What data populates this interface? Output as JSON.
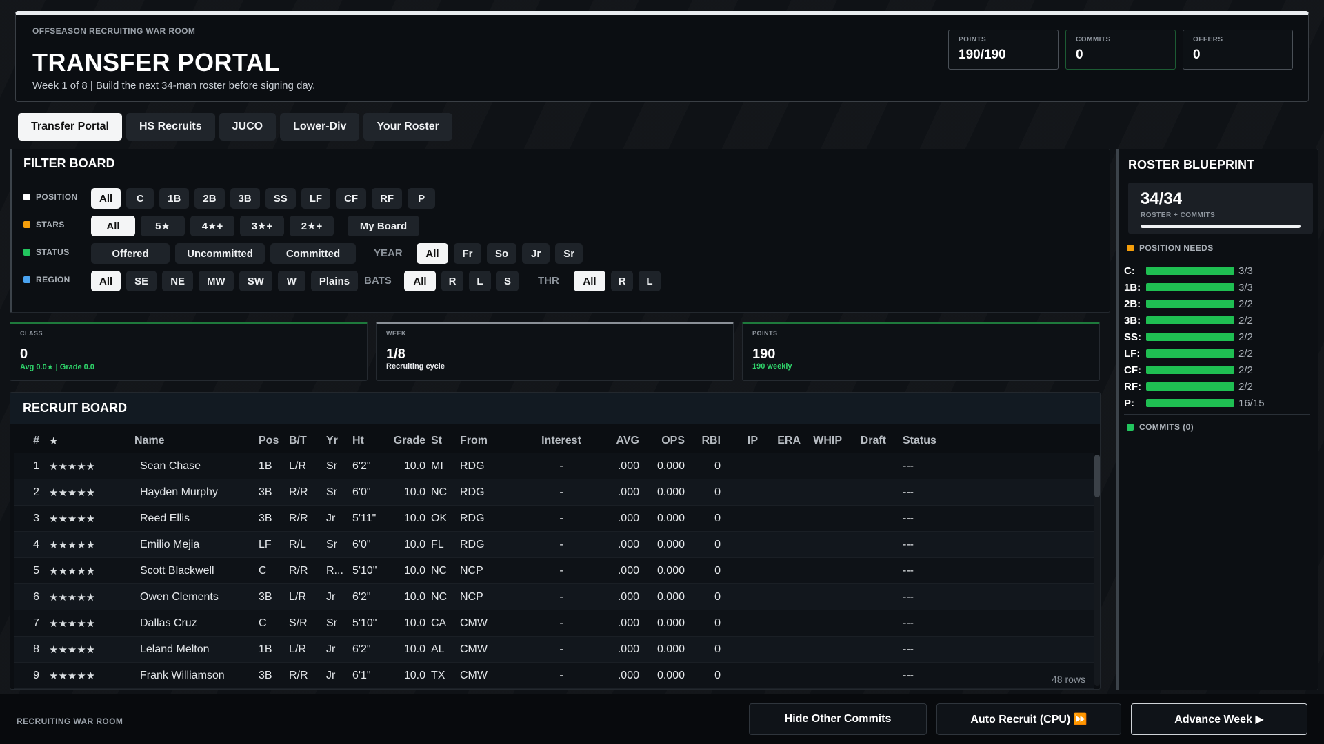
{
  "header": {
    "eyebrow": "OFFSEASON RECRUITING WAR ROOM",
    "title": "TRANSFER PORTAL",
    "subtitle": "Week 1 of 8 | Build the next 34-man roster before signing day.",
    "stats": [
      {
        "label": "POINTS",
        "value": "190/190"
      },
      {
        "label": "COMMITS",
        "value": "0"
      },
      {
        "label": "OFFERS",
        "value": "0"
      }
    ]
  },
  "tabs": [
    "Transfer Portal",
    "HS Recruits",
    "JUCO",
    "Lower-Div",
    "Your Roster"
  ],
  "filter": {
    "title": "FILTER BOARD",
    "position_label": "POSITION",
    "positions": [
      "All",
      "C",
      "1B",
      "2B",
      "3B",
      "SS",
      "LF",
      "CF",
      "RF",
      "P"
    ],
    "stars_label": "STARS",
    "stars": [
      "All",
      "5★",
      "4★+",
      "3★+",
      "2★+"
    ],
    "my_board": "My Board",
    "status_label": "STATUS",
    "statuses": [
      "Offered",
      "Uncommitted",
      "Committed"
    ],
    "year_label": "YEAR",
    "years": [
      "All",
      "Fr",
      "So",
      "Jr",
      "Sr"
    ],
    "region_label": "REGION",
    "regions": [
      "All",
      "SE",
      "NE",
      "MW",
      "SW",
      "W",
      "Plains"
    ],
    "bats_label": "BATS",
    "bats": [
      "All",
      "R",
      "L",
      "S"
    ],
    "thr_label": "THR",
    "thr": [
      "All",
      "R",
      "L"
    ]
  },
  "cards": {
    "class": {
      "label": "CLASS",
      "value": "0",
      "sub": "Avg 0.0★ | Grade 0.0"
    },
    "week": {
      "label": "WEEK",
      "value": "1/8",
      "sub": "Recruiting cycle"
    },
    "points": {
      "label": "POINTS",
      "value": "190",
      "sub": "190 weekly"
    }
  },
  "board": {
    "title": "RECRUIT BOARD",
    "columns": [
      "#",
      "★",
      "Name",
      "Pos",
      "B/T",
      "Yr",
      "Ht",
      "Grade",
      "St",
      "From",
      "Interest",
      "AVG",
      "OPS",
      "RBI",
      "IP",
      "ERA",
      "WHIP",
      "Draft",
      "Status"
    ],
    "rows": [
      [
        "1",
        "★★★★★",
        "Sean Chase",
        "1B",
        "L/R",
        "Sr",
        "6'2\"",
        "10.0",
        "MI",
        "RDG",
        "-",
        ".000",
        "0.000",
        "0",
        "",
        "",
        "",
        "",
        "---"
      ],
      [
        "2",
        "★★★★★",
        "Hayden Murphy",
        "3B",
        "R/R",
        "Sr",
        "6'0\"",
        "10.0",
        "NC",
        "RDG",
        "-",
        ".000",
        "0.000",
        "0",
        "",
        "",
        "",
        "",
        "---"
      ],
      [
        "3",
        "★★★★★",
        "Reed Ellis",
        "3B",
        "R/R",
        "Jr",
        "5'11\"",
        "10.0",
        "OK",
        "RDG",
        "-",
        ".000",
        "0.000",
        "0",
        "",
        "",
        "",
        "",
        "---"
      ],
      [
        "4",
        "★★★★★",
        "Emilio Mejia",
        "LF",
        "R/L",
        "Sr",
        "6'0\"",
        "10.0",
        "FL",
        "RDG",
        "-",
        ".000",
        "0.000",
        "0",
        "",
        "",
        "",
        "",
        "---"
      ],
      [
        "5",
        "★★★★★",
        "Scott Blackwell",
        "C",
        "R/R",
        "R...",
        "5'10\"",
        "10.0",
        "NC",
        "NCP",
        "-",
        ".000",
        "0.000",
        "0",
        "",
        "",
        "",
        "",
        "---"
      ],
      [
        "6",
        "★★★★★",
        "Owen Clements",
        "3B",
        "L/R",
        "Jr",
        "6'2\"",
        "10.0",
        "NC",
        "NCP",
        "-",
        ".000",
        "0.000",
        "0",
        "",
        "",
        "",
        "",
        "---"
      ],
      [
        "7",
        "★★★★★",
        "Dallas Cruz",
        "C",
        "S/R",
        "Sr",
        "5'10\"",
        "10.0",
        "CA",
        "CMW",
        "-",
        ".000",
        "0.000",
        "0",
        "",
        "",
        "",
        "",
        "---"
      ],
      [
        "8",
        "★★★★★",
        "Leland Melton",
        "1B",
        "L/R",
        "Jr",
        "6'2\"",
        "10.0",
        "AL",
        "CMW",
        "-",
        ".000",
        "0.000",
        "0",
        "",
        "",
        "",
        "",
        "---"
      ],
      [
        "9",
        "★★★★★",
        "Frank Williamson",
        "3B",
        "R/R",
        "Jr",
        "6'1\"",
        "10.0",
        "TX",
        "CMW",
        "-",
        ".000",
        "0.000",
        "0",
        "",
        "",
        "",
        "",
        "---"
      ]
    ],
    "rows_count": "48 rows"
  },
  "blueprint": {
    "title": "ROSTER BLUEPRINT",
    "total": "34/34",
    "total_label": "ROSTER + COMMITS",
    "total_fill": 1.0,
    "needs_label": "POSITION NEEDS",
    "needs": [
      {
        "pos": "C:",
        "count": "3/3"
      },
      {
        "pos": "1B:",
        "count": "3/3"
      },
      {
        "pos": "2B:",
        "count": "2/2"
      },
      {
        "pos": "3B:",
        "count": "2/2"
      },
      {
        "pos": "SS:",
        "count": "2/2"
      },
      {
        "pos": "LF:",
        "count": "2/2"
      },
      {
        "pos": "CF:",
        "count": "2/2"
      },
      {
        "pos": "RF:",
        "count": "2/2"
      },
      {
        "pos": "P:",
        "count": "16/15"
      }
    ],
    "commits_label": "COMMITS (0)"
  },
  "footer": {
    "label": "RECRUITING WAR ROOM",
    "hide_commits": "Hide Other Commits",
    "auto_recruit": "Auto Recruit (CPU) ⏩",
    "advance_week": "Advance Week ▶"
  },
  "colors": {
    "accent_green": "#1fbf52",
    "position_dot": "#ffffff",
    "stars_dot": "#f59e0b",
    "status_dot": "#22c55e",
    "region_dot": "#4aa3f0"
  }
}
